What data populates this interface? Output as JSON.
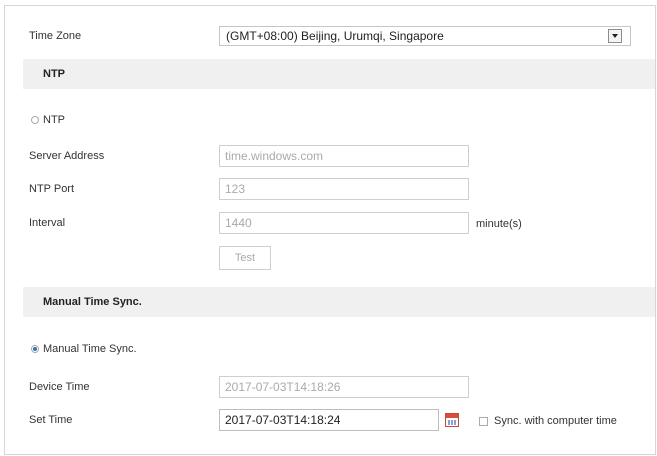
{
  "time_zone": {
    "label": "Time Zone",
    "selected": "(GMT+08:00) Beijing, Urumqi, Singapore"
  },
  "ntp_section": {
    "title": "NTP",
    "radio_label": "NTP",
    "radio_selected": false,
    "server_address": {
      "label": "Server Address",
      "value": "time.windows.com"
    },
    "ntp_port": {
      "label": "NTP Port",
      "value": "123"
    },
    "interval": {
      "label": "Interval",
      "value": "1440",
      "unit": "minute(s)"
    },
    "test_button": "Test"
  },
  "manual_section": {
    "title": "Manual Time Sync.",
    "radio_label": "Manual Time Sync.",
    "radio_selected": true,
    "device_time": {
      "label": "Device Time",
      "value": "2017-07-03T14:18:26"
    },
    "set_time": {
      "label": "Set Time",
      "value": "2017-07-03T14:18:24"
    },
    "sync_checkbox_label": "Sync. with computer time",
    "sync_checked": false
  },
  "icons": {
    "dropdown": "chevron-down-icon",
    "calendar": "calendar-icon"
  },
  "colors": {
    "section_bg": "#f0f0f0",
    "radio_selected": "#3a6fb0",
    "calendar_red": "#d8503c"
  }
}
